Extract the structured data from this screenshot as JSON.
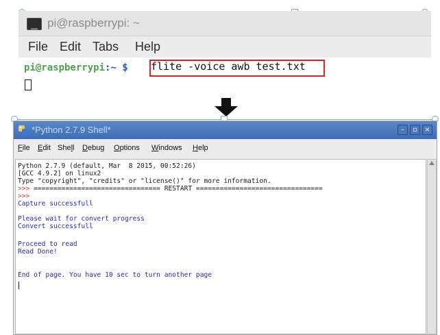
{
  "terminal": {
    "title": "pi@raspberrypi: ~",
    "menu": [
      "File",
      "Edit",
      "Tabs",
      "Help"
    ],
    "prompt_user": "pi@raspberrypi",
    "prompt_path": ":~ $",
    "command": "flite -voice awb test.txt"
  },
  "shell": {
    "title": "*Python 2.7.9 Shell*",
    "menu": [
      {
        "key": "F",
        "rest": "ile"
      },
      {
        "key": "E",
        "rest": "dit"
      },
      {
        "pre": "She",
        "key": "l",
        "rest": "l"
      },
      {
        "key": "D",
        "rest": "ebug"
      },
      {
        "key": "O",
        "rest": "ptions"
      },
      {
        "key": "W",
        "rest": "indows"
      },
      {
        "key": "H",
        "rest": "elp"
      }
    ],
    "window_buttons": {
      "minimize": "–",
      "maximize": "▫",
      "close": "×"
    },
    "lines": [
      {
        "text": "Python 2.7.9 (default, Mar  8 2015, 00:52:26)",
        "color": "black"
      },
      {
        "text": "[GCC 4.9.2] on linux2",
        "color": "black"
      },
      {
        "text": "Type \"copyright\", \"credits\" or \"license()\" for more information.",
        "color": "black"
      },
      {
        "text": ">>> ================================ RESTART ================================",
        "color": "mixed"
      },
      {
        "text": ">>> ",
        "color": "red"
      },
      {
        "text": "Capture successfull",
        "color": "blue"
      },
      {
        "text": "",
        "color": "blue"
      },
      {
        "text": "Please wait for convert progress",
        "color": "blue"
      },
      {
        "text": "Convert successfull",
        "color": "blue"
      },
      {
        "text": "",
        "color": "blue"
      },
      {
        "text": "Proceed to read",
        "color": "blue"
      },
      {
        "text": "Read Done!",
        "color": "blue"
      },
      {
        "text": "",
        "color": "blue"
      },
      {
        "text": "End of page. You have 10 sec to turn another page",
        "color": "blue"
      }
    ]
  },
  "colors": {
    "highlight_box": "#dd2222",
    "prompt_user": "#4aa44a",
    "prompt_path": "#2a55c7",
    "shell_output": "#2a2ab5",
    "shell_prompt": "#cc3b3b",
    "titlebar": "#4b77bb"
  },
  "icons": [
    "terminal-icon",
    "python-idle-icon",
    "down-arrow-icon"
  ]
}
